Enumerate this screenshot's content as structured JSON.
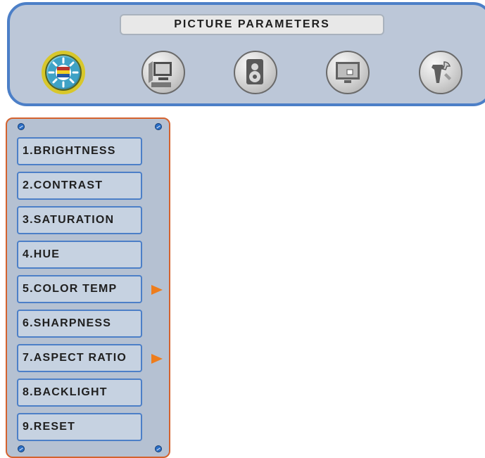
{
  "header": {
    "title": "PICTURE PARAMETERS",
    "icons": [
      {
        "name": "picture-icon",
        "active": true
      },
      {
        "name": "computer-icon",
        "active": false
      },
      {
        "name": "speaker-icon",
        "active": false
      },
      {
        "name": "screen-icon",
        "active": false
      },
      {
        "name": "tools-icon",
        "active": false
      }
    ]
  },
  "menu": {
    "items": [
      {
        "label": "1.BRIGHTNESS",
        "has_submenu": false
      },
      {
        "label": "2.CONTRAST",
        "has_submenu": false
      },
      {
        "label": "3.SATURATION",
        "has_submenu": false
      },
      {
        "label": "4.HUE",
        "has_submenu": false
      },
      {
        "label": "5.COLOR TEMP",
        "has_submenu": true
      },
      {
        "label": "6.SHARPNESS",
        "has_submenu": false
      },
      {
        "label": "7.ASPECT RATIO",
        "has_submenu": true
      },
      {
        "label": "8.BACKLIGHT",
        "has_submenu": false
      },
      {
        "label": "9.RESET",
        "has_submenu": false
      }
    ]
  },
  "colors": {
    "panel": "#bcc7d8",
    "panel_border": "#4c7fc7",
    "menu_border": "#d4622e",
    "arrow": "#ee7d1c"
  }
}
